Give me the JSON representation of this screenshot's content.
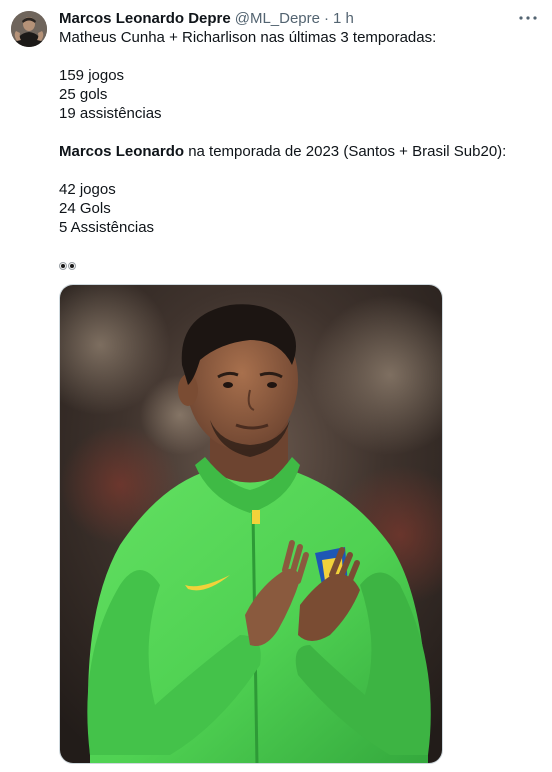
{
  "tweet": {
    "author": {
      "display_name": "Marcos Leonardo Depre",
      "handle": "@ML_Depre",
      "separator": "·",
      "time": "1 h"
    },
    "more_icon": "more-horizontal-icon",
    "lines": {
      "l1": "Matheus Cunha + Richarlison nas últimas 3 temporadas:",
      "l2": "159 jogos",
      "l3": "25 gols",
      "l4": "19 assistências",
      "l5_bold": "Marcos Leonardo",
      "l5_rest": " na temporada de 2023 (Santos + Brasil Sub20):",
      "l6": "42 jogos",
      "l7": "24 Gols",
      "l8": "5 Assistências"
    },
    "emoji": "eyes",
    "media": {
      "description_icon": "player-photo",
      "colors": {
        "jacket": "#4fd152",
        "jacket_shadow": "#2f9d3a",
        "skin": "#8a5a3e",
        "hair": "#1c1512",
        "background": "#3a2f2b"
      }
    }
  }
}
